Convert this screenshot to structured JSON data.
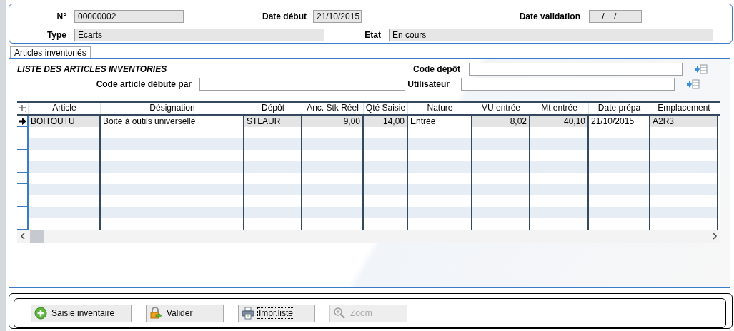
{
  "header": {
    "fields": [
      {
        "label": "N°",
        "value": "00000002",
        "readonly": true
      },
      {
        "label": "Date début",
        "value": "21/10/2015",
        "readonly": true
      },
      {
        "label": "Date validation",
        "value": "__/__/____",
        "readonly": true
      },
      {
        "label": "Type",
        "value": "Ecarts",
        "readonly": true
      },
      {
        "label": "Etat",
        "value": "En cours",
        "readonly": true
      }
    ]
  },
  "tabs": [
    {
      "label": "Articles inventoriés",
      "selected": true
    }
  ],
  "list": {
    "title": "LISTE DES ARTICLES INVENTORIES",
    "filters": [
      {
        "label": "Code dépôt",
        "lookup": true
      },
      {
        "label": "Code article débute par",
        "lookup": false
      },
      {
        "label": "Utilisateur",
        "lookup": true
      }
    ]
  },
  "table": {
    "columns": [
      {
        "label": "Article",
        "readonly": true
      },
      {
        "label": "Désignation"
      },
      {
        "label": "Dépôt",
        "readonly": true
      },
      {
        "label": "Anc. Stk Réel",
        "readonly": true
      },
      {
        "label": "Qté Saisie",
        "readonly": true
      },
      {
        "label": "Nature"
      },
      {
        "label": "VU entrée",
        "readonly": true
      },
      {
        "label": "Mt entrée",
        "readonly": true
      },
      {
        "label": "Date prépa"
      },
      {
        "label": "Emplacement",
        "readonly": true
      }
    ],
    "rows": [
      {
        "selected": true,
        "cells": [
          "BOITOUTU",
          "Boite à outils universelle",
          "STLAUR",
          "9,00",
          "14,00",
          "Entrée",
          "8,02",
          "40,10",
          "21/10/2015",
          "A2R3"
        ]
      }
    ]
  },
  "buttons": [
    {
      "label": "Saisie inventaire",
      "disabled": false,
      "focused": false
    },
    {
      "label": "Valider",
      "disabled": false,
      "focused": false
    },
    {
      "label": "Impr.liste",
      "disabled": false,
      "focused": true
    },
    {
      "label": "Zoom",
      "disabled": true,
      "focused": false
    }
  ]
}
